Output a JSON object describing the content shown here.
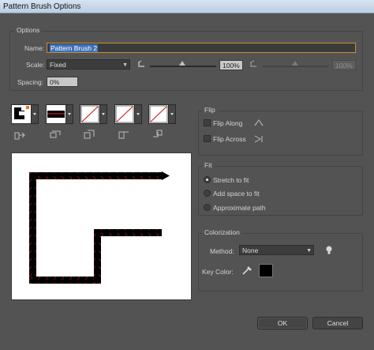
{
  "window": {
    "title": "Pattern Brush Options"
  },
  "options": {
    "group_label": "Options",
    "name_label": "Name:",
    "name_value": "Pattern Brush 2",
    "scale_label": "Scale:",
    "scale_value": "Fixed",
    "scale_percent": "100%",
    "scale_percent_2": "100%",
    "spacing_label": "Spacing:",
    "spacing_value": "0%"
  },
  "tiles": [
    {
      "name": "side-tile",
      "icon": "side-tile-icon"
    },
    {
      "name": "outer-corner-tile",
      "icon": "outer-corner-tile-icon"
    },
    {
      "name": "inner-corner-tile",
      "icon": "inner-corner-tile-icon"
    },
    {
      "name": "start-tile",
      "icon": "start-tile-icon"
    },
    {
      "name": "end-tile",
      "icon": "end-tile-icon"
    }
  ],
  "flip": {
    "group_label": "Flip",
    "along_label": "Flip Along",
    "across_label": "Flip Across"
  },
  "fit": {
    "group_label": "Fit",
    "options": [
      "Stretch to fit",
      "Add space to fit",
      "Approximate path"
    ],
    "selected": 0
  },
  "colorization": {
    "group_label": "Colorization",
    "method_label": "Method:",
    "method_value": "None",
    "key_color_label": "Key Color:",
    "key_color": "#000000"
  },
  "buttons": {
    "ok": "OK",
    "cancel": "Cancel"
  },
  "colors": {
    "accent_selection": "#3d6fb8",
    "focus_border": "#c8902f",
    "dialog_bg": "#535353"
  }
}
